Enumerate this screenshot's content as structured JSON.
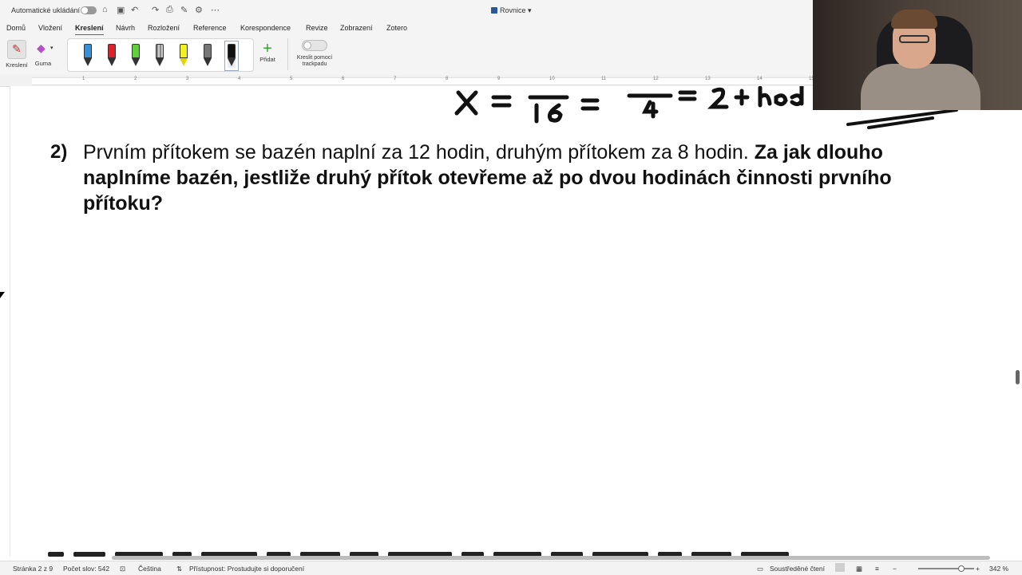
{
  "titlebar": {
    "autosave_label": "Automatické ukládání",
    "document_title": "Rovnice"
  },
  "tabs": [
    {
      "label": "Domů"
    },
    {
      "label": "Vložení"
    },
    {
      "label": "Kreslení",
      "active": true
    },
    {
      "label": "Návrh"
    },
    {
      "label": "Rozložení"
    },
    {
      "label": "Reference"
    },
    {
      "label": "Korespondence"
    },
    {
      "label": "Revize"
    },
    {
      "label": "Zobrazení"
    },
    {
      "label": "Zotero"
    }
  ],
  "ribbon": {
    "draw_label": "Kreslení",
    "eraser_label": "Guma",
    "pen_colors": [
      "#3a8fd6",
      "#d9252a",
      "#5fd13a",
      "#888888",
      "#f2f21e",
      "#777777",
      "#111111"
    ],
    "add_label": "Přidat",
    "trackpad_label_1": "Kreslit pomocí",
    "trackpad_label_2": "trackpadu",
    "trackpad_toggle": "0"
  },
  "document": {
    "problem_number": "2)",
    "problem_regular": "Prvním přítokem se bazén naplní za 12 hodin, druhým přítokem za 8 hodin. ",
    "problem_bold": "Za jak dlouho naplníme bazén, jestliže druhý přítok otevřeme až po dvou hodinách činnosti prvního přítoku?"
  },
  "statusbar": {
    "page": "Stránka 2 z 9",
    "word_count": "Počet slov: 542",
    "language": "Čeština",
    "accessibility": "Přístupnost: Prostudujte si doporučení",
    "focus_mode": "Soustředěné čtení",
    "zoom": "342 %"
  }
}
